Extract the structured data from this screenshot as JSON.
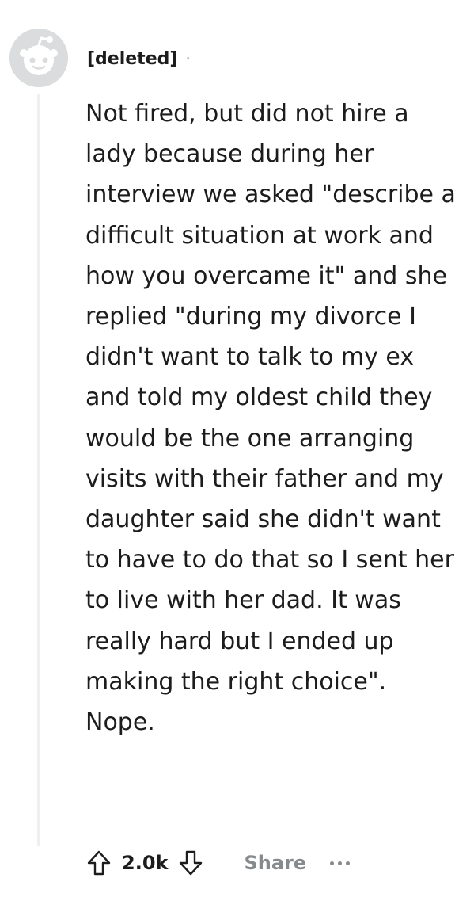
{
  "comment": {
    "author": "[deleted]",
    "separator": "·",
    "text": "Not fired, but did not hire a lady because during her interview we asked \"describe a difficult situation at work and how you overcame it\" and she replied \"during my divorce I didn't want to talk to my ex and told my oldest child they would be the one arranging visits with their father and my daughter said she didn't want to have to do that so I sent her to live with her dad. It was really hard but I ended up making the right choice\". Nope.",
    "score": "2.0k",
    "share_label": "Share"
  },
  "icons": {
    "avatar": "reddit-avatar-icon",
    "upvote": "upvote-arrow-icon",
    "downvote": "downvote-arrow-icon",
    "more": "more-options-icon"
  },
  "colors": {
    "text": "#1c1c1c",
    "muted": "#878a8c",
    "avatar": "#dadcdd",
    "thread_line": "#edeff1"
  }
}
